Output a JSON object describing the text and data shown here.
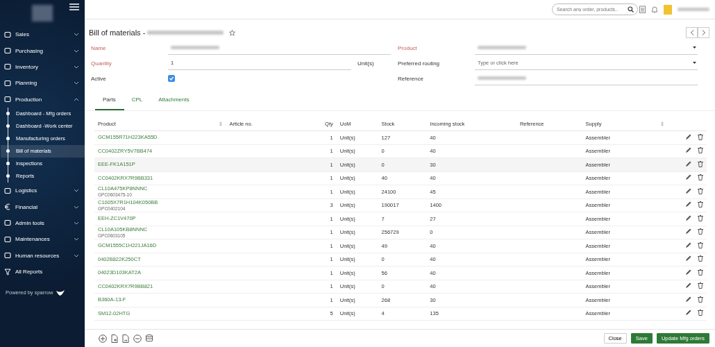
{
  "sidebar": {
    "items": [
      {
        "label": "Sales",
        "kind": "group"
      },
      {
        "label": "Purchasing",
        "kind": "group"
      },
      {
        "label": "Inventory",
        "kind": "group"
      },
      {
        "label": "Planning",
        "kind": "group"
      },
      {
        "label": "Production",
        "kind": "group",
        "children": [
          {
            "label": "Dashboard - Mfg orders",
            "selected": false
          },
          {
            "label": "Dashboard -Work center",
            "selected": false
          },
          {
            "label": "Manufacturing orders",
            "selected": false
          },
          {
            "label": "Bill of materials",
            "selected": true
          },
          {
            "label": "Inspections",
            "selected": false
          },
          {
            "label": "Reports",
            "selected": false
          }
        ]
      },
      {
        "label": "Logistics",
        "kind": "group"
      },
      {
        "label": "Financial",
        "kind": "group"
      },
      {
        "label": "Admin tools",
        "kind": "group"
      },
      {
        "label": "Maintenances",
        "kind": "group"
      },
      {
        "label": "Human resources",
        "kind": "group"
      },
      {
        "label": "All Reports",
        "kind": "link"
      }
    ],
    "footer": "Powered by sparrow"
  },
  "topbar": {
    "search": {
      "placeholder": "Search any order, products.."
    }
  },
  "page": {
    "title": "Bill of materials - "
  },
  "form": {
    "left": [
      {
        "label": "Name",
        "required": true,
        "kind": "text"
      },
      {
        "label": "Quantity",
        "required": true,
        "kind": "number",
        "value": "1",
        "unit": "Unit(s)"
      },
      {
        "label": "Active",
        "required": false,
        "kind": "checkbox",
        "checked": true
      }
    ],
    "right": [
      {
        "label": "Product",
        "required": true,
        "kind": "select"
      },
      {
        "label": "Preferred routing",
        "required": false,
        "kind": "select",
        "placeholder": "Type or click here"
      },
      {
        "label": "Reference",
        "required": false,
        "kind": "text"
      }
    ]
  },
  "tabs": [
    {
      "label": "Parts",
      "selected": true
    },
    {
      "label": "CPL",
      "selected": false
    },
    {
      "label": "Attachments",
      "selected": false
    }
  ],
  "table": {
    "columns": [
      {
        "label": "Product",
        "sortable": true
      },
      {
        "label": "Article no.",
        "sortable": false
      },
      {
        "label": "Qty",
        "sortable": false
      },
      {
        "label": "UoM",
        "sortable": false
      },
      {
        "label": "Stock",
        "sortable": false
      },
      {
        "label": "Incoming stock",
        "sortable": false
      },
      {
        "label": "Reference",
        "sortable": false
      },
      {
        "label": "Supply",
        "sortable": true
      }
    ],
    "rows": [
      {
        "product": "GCM155R71H223KA55D",
        "qty": "1",
        "uom": "Unit(s)",
        "stock": "127",
        "incoming": "40",
        "supply": "Assembler"
      },
      {
        "product": "CC0402ZRY5V7BB474",
        "qty": "1",
        "uom": "Unit(s)",
        "stock": "0",
        "incoming": "40",
        "supply": "Assembler"
      },
      {
        "product": "EEE-FK1A151P",
        "qty": "1",
        "uom": "Unit(s)",
        "stock": "0",
        "incoming": "30",
        "supply": "Assembler"
      },
      {
        "product": "CC0402KRX7R9BB331",
        "qty": "1",
        "uom": "Unit(s)",
        "stock": "40",
        "incoming": "40",
        "supply": "Assembler"
      },
      {
        "product": "CL10A475KP8NNNC",
        "sub": "GPC0603475-10",
        "qty": "1",
        "uom": "Unit(s)",
        "stock": "24100",
        "incoming": "45",
        "supply": "Assembler"
      },
      {
        "product": "C1005X7R1H104K050BB",
        "sub": "GPC0402104",
        "qty": "3",
        "uom": "Unit(s)",
        "stock": "190017",
        "incoming": "1400",
        "supply": "Assembler"
      },
      {
        "product": "EEH-ZC1V470P",
        "qty": "1",
        "uom": "Unit(s)",
        "stock": "7",
        "incoming": "27",
        "supply": "Assembler"
      },
      {
        "product": "CL10A105KB8NNNC",
        "sub": "GPC0603105",
        "qty": "1",
        "uom": "Unit(s)",
        "stock": "256729",
        "incoming": "0",
        "supply": "Assembler"
      },
      {
        "product": "GCM1555C1H221JA16D",
        "qty": "1",
        "uom": "Unit(s)",
        "stock": "49",
        "incoming": "40",
        "supply": "Assembler"
      },
      {
        "product": "0402B822K250CT",
        "qty": "1",
        "uom": "Unit(s)",
        "stock": "0",
        "incoming": "40",
        "supply": "Assembler"
      },
      {
        "product": "04023D103KAT2A",
        "qty": "1",
        "uom": "Unit(s)",
        "stock": "56",
        "incoming": "40",
        "supply": "Assembler"
      },
      {
        "product": "CC0402KRX7R9BB821",
        "qty": "1",
        "uom": "Unit(s)",
        "stock": "0",
        "incoming": "40",
        "supply": "Assembler"
      },
      {
        "product": "B360A-13-F",
        "qty": "1",
        "uom": "Unit(s)",
        "stock": "268",
        "incoming": "30",
        "supply": "Assembler"
      },
      {
        "product": "SM12-02HTG",
        "qty": "5",
        "uom": "Unit(s)",
        "stock": "4",
        "incoming": "135",
        "supply": "Assembler"
      }
    ]
  },
  "buttons": [
    {
      "label": "Close",
      "kind": "secondary"
    },
    {
      "label": "Save",
      "kind": "primary"
    },
    {
      "label": "Update Mfg orders",
      "kind": "primary"
    }
  ]
}
